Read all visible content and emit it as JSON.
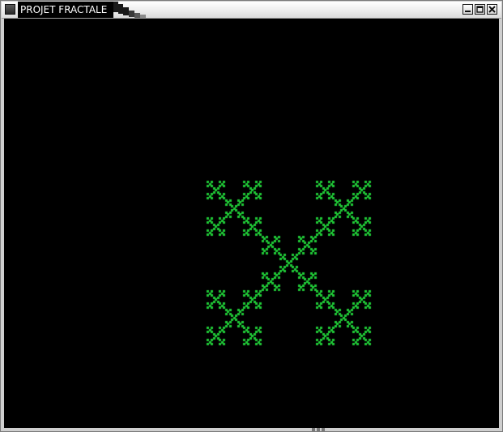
{
  "window": {
    "title": "PROJET FRACTALE"
  },
  "canvas": {
    "background": "#000000",
    "fractal_color": "#1fc936",
    "fractal_type": "Vicsek X-fractal",
    "depth": 4
  },
  "controls": {
    "minimize_icon": "minimize-icon",
    "maximize_icon": "maximize-icon",
    "close_icon": "close-icon"
  }
}
